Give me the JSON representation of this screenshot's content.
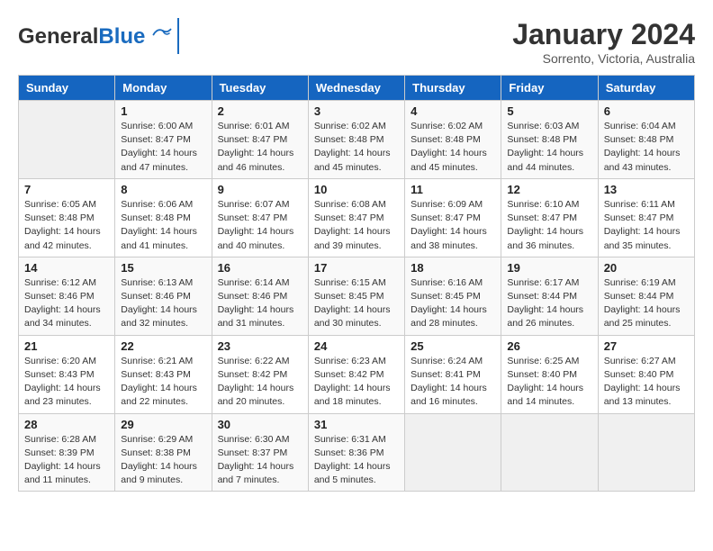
{
  "header": {
    "logo_general": "General",
    "logo_blue": "Blue",
    "month_title": "January 2024",
    "subtitle": "Sorrento, Victoria, Australia"
  },
  "weekdays": [
    "Sunday",
    "Monday",
    "Tuesday",
    "Wednesday",
    "Thursday",
    "Friday",
    "Saturday"
  ],
  "weeks": [
    [
      {
        "day": "",
        "info": ""
      },
      {
        "day": "1",
        "info": "Sunrise: 6:00 AM\nSunset: 8:47 PM\nDaylight: 14 hours\nand 47 minutes."
      },
      {
        "day": "2",
        "info": "Sunrise: 6:01 AM\nSunset: 8:47 PM\nDaylight: 14 hours\nand 46 minutes."
      },
      {
        "day": "3",
        "info": "Sunrise: 6:02 AM\nSunset: 8:48 PM\nDaylight: 14 hours\nand 45 minutes."
      },
      {
        "day": "4",
        "info": "Sunrise: 6:02 AM\nSunset: 8:48 PM\nDaylight: 14 hours\nand 45 minutes."
      },
      {
        "day": "5",
        "info": "Sunrise: 6:03 AM\nSunset: 8:48 PM\nDaylight: 14 hours\nand 44 minutes."
      },
      {
        "day": "6",
        "info": "Sunrise: 6:04 AM\nSunset: 8:48 PM\nDaylight: 14 hours\nand 43 minutes."
      }
    ],
    [
      {
        "day": "7",
        "info": "Sunrise: 6:05 AM\nSunset: 8:48 PM\nDaylight: 14 hours\nand 42 minutes."
      },
      {
        "day": "8",
        "info": "Sunrise: 6:06 AM\nSunset: 8:48 PM\nDaylight: 14 hours\nand 41 minutes."
      },
      {
        "day": "9",
        "info": "Sunrise: 6:07 AM\nSunset: 8:47 PM\nDaylight: 14 hours\nand 40 minutes."
      },
      {
        "day": "10",
        "info": "Sunrise: 6:08 AM\nSunset: 8:47 PM\nDaylight: 14 hours\nand 39 minutes."
      },
      {
        "day": "11",
        "info": "Sunrise: 6:09 AM\nSunset: 8:47 PM\nDaylight: 14 hours\nand 38 minutes."
      },
      {
        "day": "12",
        "info": "Sunrise: 6:10 AM\nSunset: 8:47 PM\nDaylight: 14 hours\nand 36 minutes."
      },
      {
        "day": "13",
        "info": "Sunrise: 6:11 AM\nSunset: 8:47 PM\nDaylight: 14 hours\nand 35 minutes."
      }
    ],
    [
      {
        "day": "14",
        "info": "Sunrise: 6:12 AM\nSunset: 8:46 PM\nDaylight: 14 hours\nand 34 minutes."
      },
      {
        "day": "15",
        "info": "Sunrise: 6:13 AM\nSunset: 8:46 PM\nDaylight: 14 hours\nand 32 minutes."
      },
      {
        "day": "16",
        "info": "Sunrise: 6:14 AM\nSunset: 8:46 PM\nDaylight: 14 hours\nand 31 minutes."
      },
      {
        "day": "17",
        "info": "Sunrise: 6:15 AM\nSunset: 8:45 PM\nDaylight: 14 hours\nand 30 minutes."
      },
      {
        "day": "18",
        "info": "Sunrise: 6:16 AM\nSunset: 8:45 PM\nDaylight: 14 hours\nand 28 minutes."
      },
      {
        "day": "19",
        "info": "Sunrise: 6:17 AM\nSunset: 8:44 PM\nDaylight: 14 hours\nand 26 minutes."
      },
      {
        "day": "20",
        "info": "Sunrise: 6:19 AM\nSunset: 8:44 PM\nDaylight: 14 hours\nand 25 minutes."
      }
    ],
    [
      {
        "day": "21",
        "info": "Sunrise: 6:20 AM\nSunset: 8:43 PM\nDaylight: 14 hours\nand 23 minutes."
      },
      {
        "day": "22",
        "info": "Sunrise: 6:21 AM\nSunset: 8:43 PM\nDaylight: 14 hours\nand 22 minutes."
      },
      {
        "day": "23",
        "info": "Sunrise: 6:22 AM\nSunset: 8:42 PM\nDaylight: 14 hours\nand 20 minutes."
      },
      {
        "day": "24",
        "info": "Sunrise: 6:23 AM\nSunset: 8:42 PM\nDaylight: 14 hours\nand 18 minutes."
      },
      {
        "day": "25",
        "info": "Sunrise: 6:24 AM\nSunset: 8:41 PM\nDaylight: 14 hours\nand 16 minutes."
      },
      {
        "day": "26",
        "info": "Sunrise: 6:25 AM\nSunset: 8:40 PM\nDaylight: 14 hours\nand 14 minutes."
      },
      {
        "day": "27",
        "info": "Sunrise: 6:27 AM\nSunset: 8:40 PM\nDaylight: 14 hours\nand 13 minutes."
      }
    ],
    [
      {
        "day": "28",
        "info": "Sunrise: 6:28 AM\nSunset: 8:39 PM\nDaylight: 14 hours\nand 11 minutes."
      },
      {
        "day": "29",
        "info": "Sunrise: 6:29 AM\nSunset: 8:38 PM\nDaylight: 14 hours\nand 9 minutes."
      },
      {
        "day": "30",
        "info": "Sunrise: 6:30 AM\nSunset: 8:37 PM\nDaylight: 14 hours\nand 7 minutes."
      },
      {
        "day": "31",
        "info": "Sunrise: 6:31 AM\nSunset: 8:36 PM\nDaylight: 14 hours\nand 5 minutes."
      },
      {
        "day": "",
        "info": ""
      },
      {
        "day": "",
        "info": ""
      },
      {
        "day": "",
        "info": ""
      }
    ]
  ]
}
